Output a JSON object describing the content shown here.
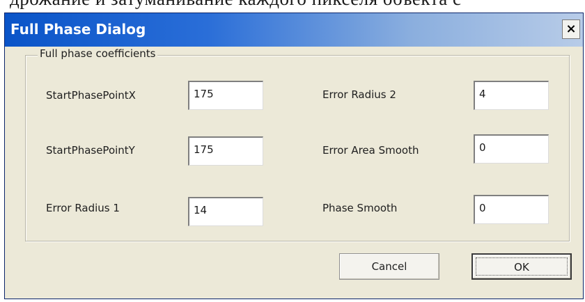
{
  "top_text": "дрожание и затуманивание каждого пикселя объекта с",
  "dialog": {
    "title": "Full Phase Dialog",
    "close_glyph": "×"
  },
  "group": {
    "legend": "Full phase coefficients"
  },
  "fields": {
    "start_x": {
      "label": "StartPhasePointX",
      "value": "175"
    },
    "start_y": {
      "label": "StartPhasePointY",
      "value": "175"
    },
    "error_radius_1": {
      "label": "Error Radius 1",
      "value": "14"
    },
    "error_radius_2": {
      "label": "Error Radius 2",
      "value": "4"
    },
    "error_area_smooth": {
      "label": "Error Area Smooth",
      "value": "0"
    },
    "phase_smooth": {
      "label": "Phase Smooth",
      "value": "0"
    }
  },
  "buttons": {
    "cancel": "Cancel",
    "ok": "OK"
  },
  "colors": {
    "titlebar_start": "#0a54c8",
    "titlebar_end": "#b8cce8",
    "dialog_bg": "#ece9d8"
  }
}
